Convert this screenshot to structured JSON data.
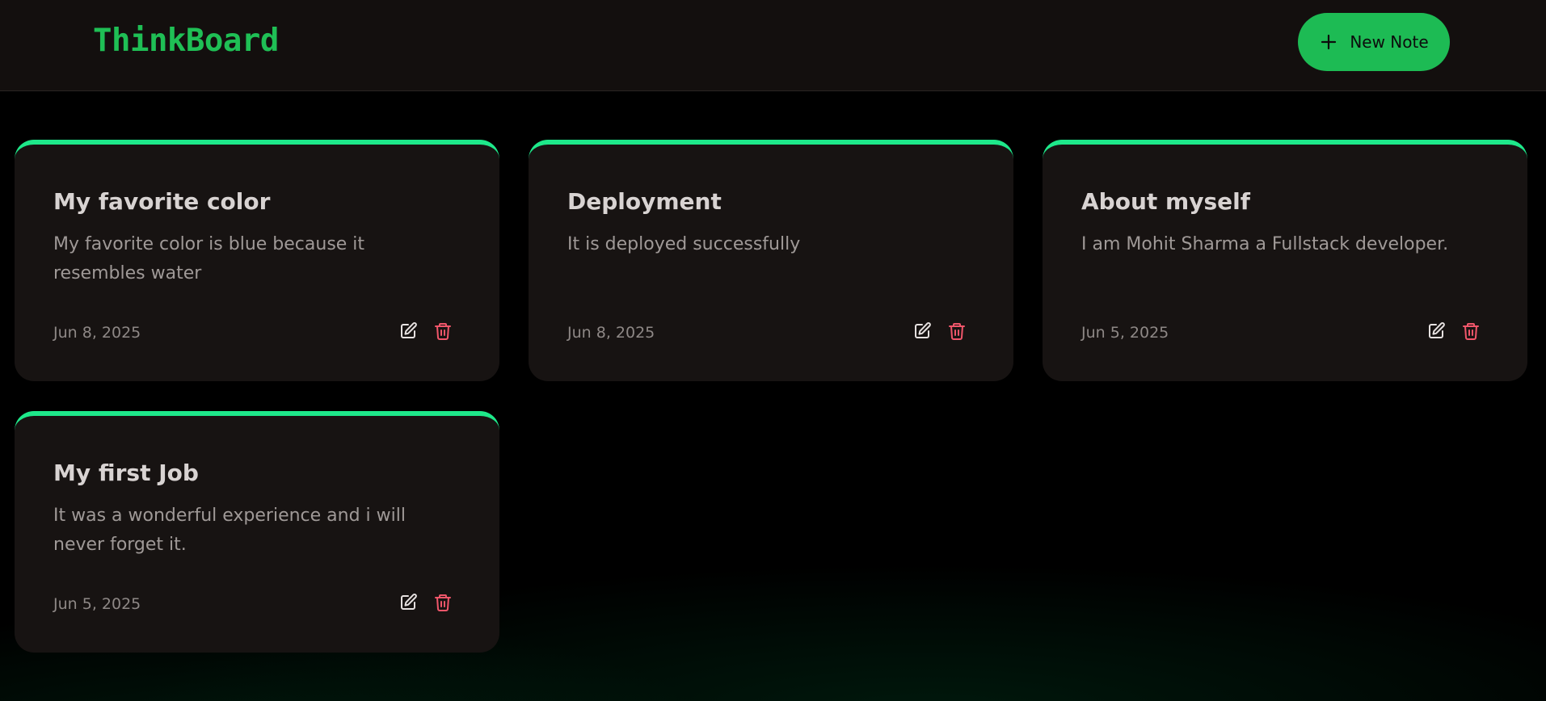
{
  "app": {
    "title": "ThinkBoard"
  },
  "header": {
    "new_note_label": "New Note"
  },
  "notes": [
    {
      "title": "My favorite color",
      "content": "My favorite color is blue because it resembles water",
      "date": "Jun 8, 2025"
    },
    {
      "title": "Deployment",
      "content": "It is deployed successfully",
      "date": "Jun 8, 2025"
    },
    {
      "title": "About myself",
      "content": "I am Mohit Sharma a Fullstack developer.",
      "date": "Jun 5, 2025"
    },
    {
      "title": "My first Job",
      "content": "It was a wonderful experience and i will never forget it.",
      "date": "Jun 5, 2025"
    }
  ],
  "icons": {
    "add": "plus-icon",
    "edit": "pen-square-icon",
    "delete": "trash-icon"
  },
  "colors": {
    "brand": "#1fbf55",
    "button_bg": "#1dbb54",
    "card_accent": "#1ee88a",
    "card_bg": "#171312",
    "header_bg": "#130f0e",
    "delete": "#f0566a"
  }
}
